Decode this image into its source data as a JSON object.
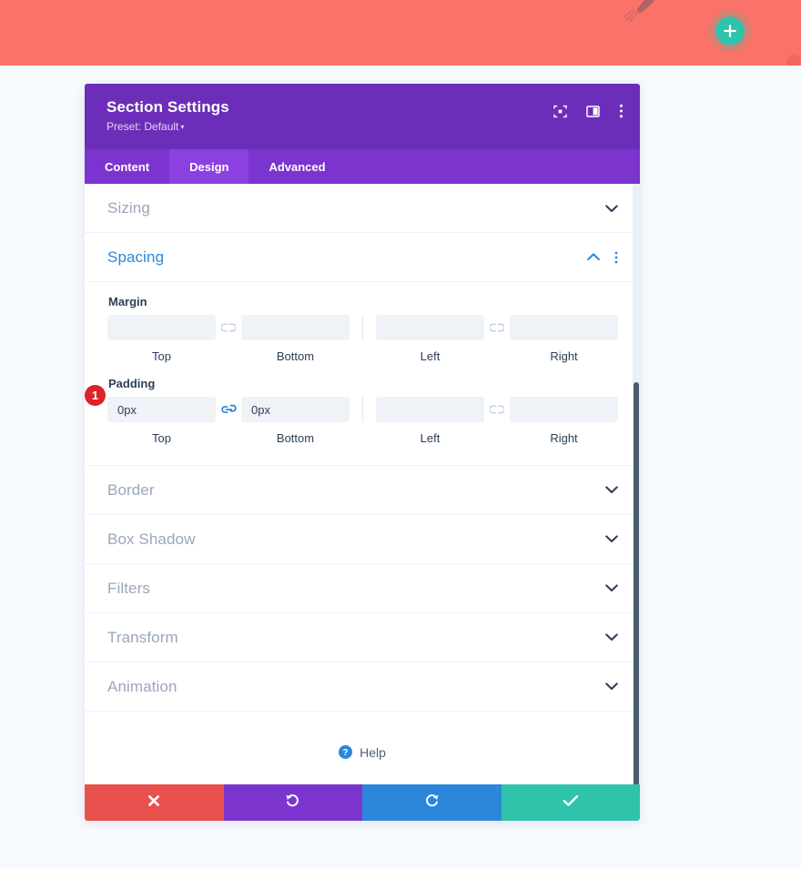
{
  "banner": {
    "add_button_icon": "plus-icon",
    "decoration_icon": "rocket-icon",
    "color": "#fa7268",
    "add_button_color": "#2fc3ac"
  },
  "modal": {
    "title": "Section Settings",
    "preset_label": "Preset: Default",
    "preset_caret": "▾",
    "header_color": "#6c2eb9",
    "header_icons": [
      {
        "name": "focus-target-icon"
      },
      {
        "name": "layout-columns-icon"
      },
      {
        "name": "more-vertical-icon"
      }
    ],
    "tabs": [
      {
        "label": "Content",
        "active": false
      },
      {
        "label": "Design",
        "active": true
      },
      {
        "label": "Advanced",
        "active": false
      }
    ],
    "tab_bar_color": "#7b35ce",
    "tab_active_color": "#8b40e0"
  },
  "sections": {
    "sizing": {
      "label": "Sizing",
      "state": "collapsed"
    },
    "spacing": {
      "label": "Spacing",
      "state": "expanded",
      "accent_color": "#2b87da",
      "margin": {
        "label": "Margin",
        "linked_top_bottom": false,
        "linked_left_right": false,
        "fields": [
          {
            "sublabel": "Top",
            "value": "",
            "placeholder": ""
          },
          {
            "sublabel": "Bottom",
            "value": "",
            "placeholder": ""
          },
          {
            "sublabel": "Left",
            "value": "",
            "placeholder": ""
          },
          {
            "sublabel": "Right",
            "value": "",
            "placeholder": ""
          }
        ]
      },
      "padding": {
        "label": "Padding",
        "linked_top_bottom": true,
        "linked_left_right": false,
        "badge": "1",
        "badge_color": "#d9242a",
        "fields": [
          {
            "sublabel": "Top",
            "value": "0px",
            "placeholder": ""
          },
          {
            "sublabel": "Bottom",
            "value": "0px",
            "placeholder": ""
          },
          {
            "sublabel": "Left",
            "value": "",
            "placeholder": ""
          },
          {
            "sublabel": "Right",
            "value": "",
            "placeholder": ""
          }
        ]
      }
    },
    "collapsed_list": [
      {
        "label": "Border"
      },
      {
        "label": "Box Shadow"
      },
      {
        "label": "Filters"
      },
      {
        "label": "Transform"
      },
      {
        "label": "Animation"
      }
    ]
  },
  "help": {
    "label": "Help",
    "icon": "question-circle-icon"
  },
  "footer": {
    "buttons": [
      {
        "name": "cancel-button",
        "icon": "close-icon",
        "color": "#e8504d"
      },
      {
        "name": "undo-button",
        "icon": "undo-icon",
        "color": "#7b35ce"
      },
      {
        "name": "redo-button",
        "icon": "redo-icon",
        "color": "#2b87da"
      },
      {
        "name": "save-button",
        "icon": "check-icon",
        "color": "#2fc3ac"
      }
    ]
  }
}
